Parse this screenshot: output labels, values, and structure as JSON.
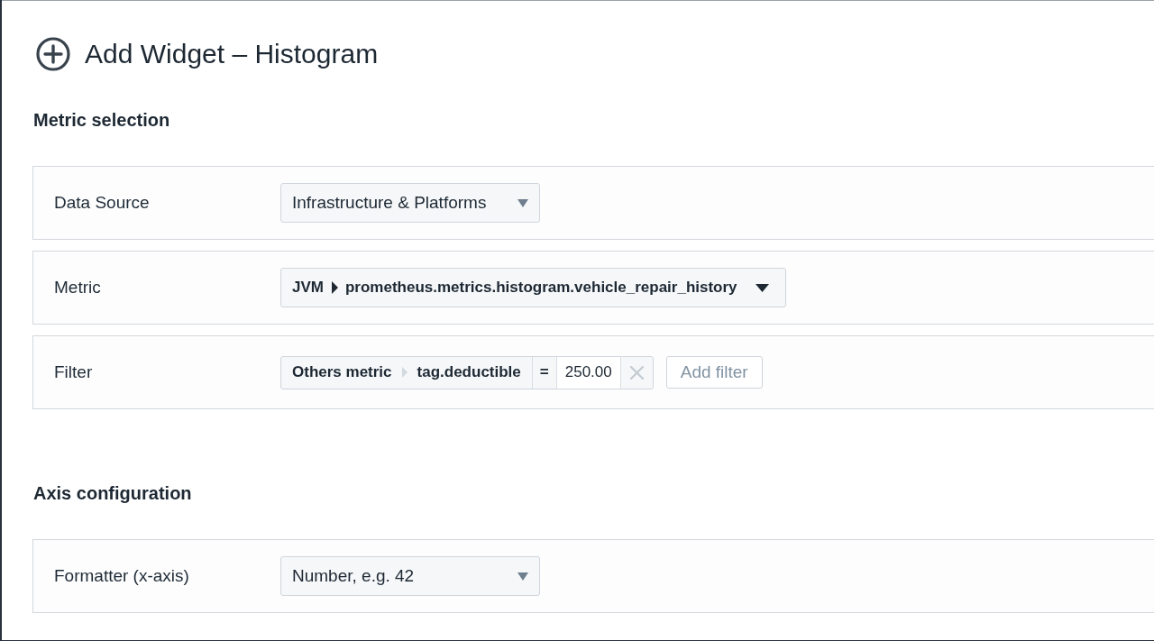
{
  "dialog": {
    "title": "Add Widget – Histogram"
  },
  "sections": [
    {
      "heading": "Metric selection",
      "fields": [
        {
          "kind": "select",
          "label": "Data Source",
          "value": "Infrastructure & Platforms"
        },
        {
          "kind": "metric",
          "label": "Metric",
          "group": "JVM",
          "value": "prometheus.metrics.histogram.vehicle_repair_history"
        },
        {
          "kind": "filter",
          "label": "Filter",
          "filters": [
            {
              "group": "Others metric",
              "tag": "tag.deductible",
              "operator": "=",
              "value": "250.00"
            }
          ],
          "add_button": "Add filter"
        }
      ]
    },
    {
      "heading": "Axis configuration",
      "fields": [
        {
          "kind": "select",
          "label": "Formatter (x-axis)",
          "value": "Number, e.g. 42"
        }
      ]
    }
  ]
}
